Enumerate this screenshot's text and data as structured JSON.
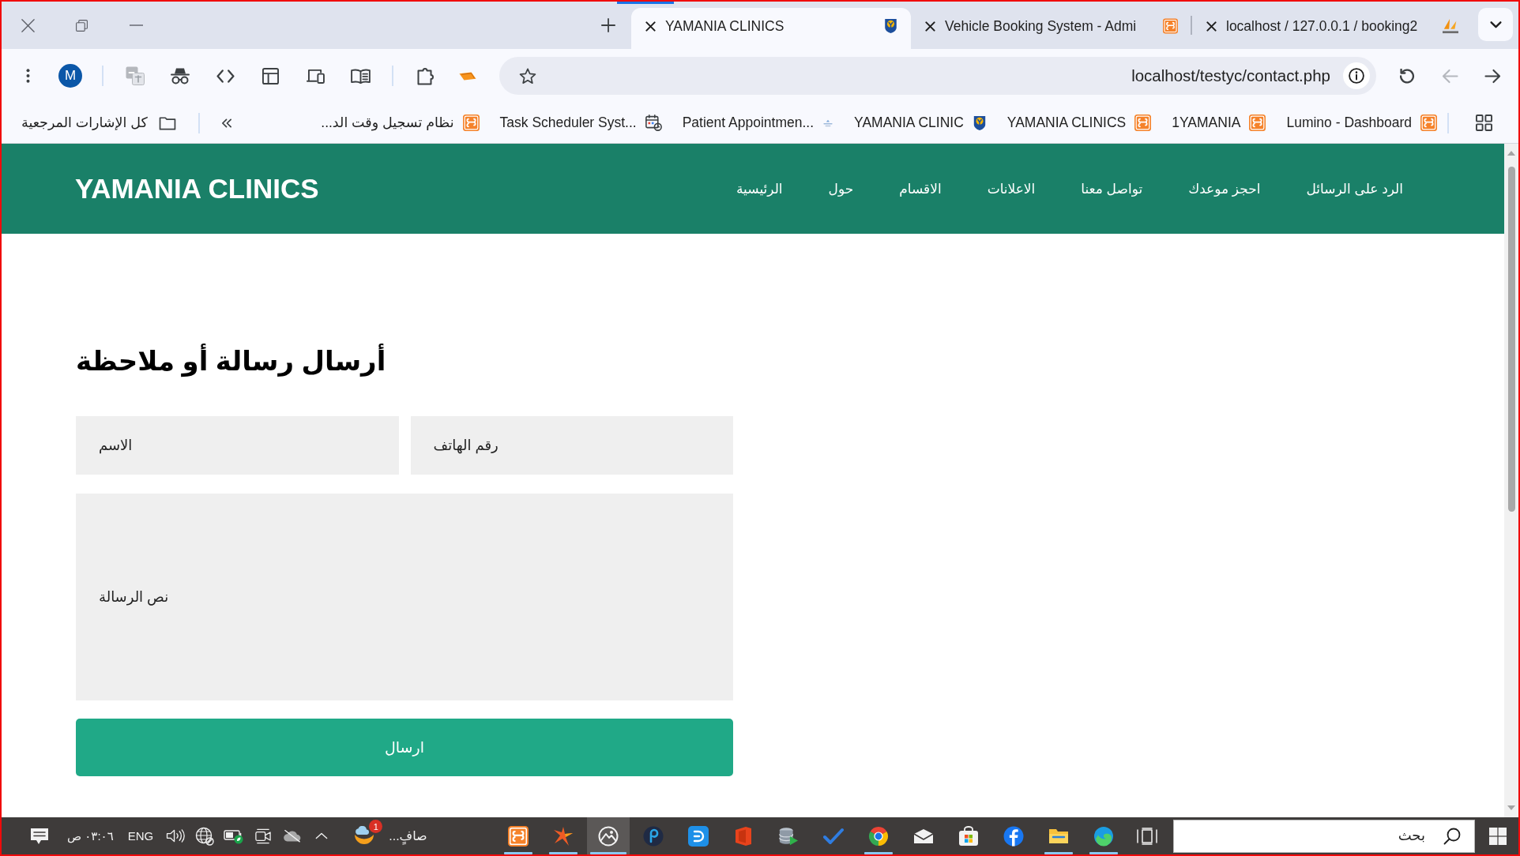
{
  "window": {
    "tabs": [
      {
        "title": "localhost / 127.0.0.1 / booking2",
        "selected": false
      },
      {
        "title": "Vehicle Booking System - Admi",
        "selected": false
      },
      {
        "title": "YAMANIA CLINICS",
        "selected": true
      }
    ]
  },
  "toolbar": {
    "profile_initial": "M",
    "url": "localhost/testyc/contact.php",
    "back": {
      "disabled": false
    },
    "forward": {
      "disabled": true
    }
  },
  "bookmarks_bar": {
    "items": [
      {
        "label": "Lumino - Dashboard"
      },
      {
        "label": "1YAMANIA"
      },
      {
        "label": "YAMANIA CLINICS"
      },
      {
        "label": "YAMANIA CLINIC"
      },
      {
        "label": "Patient Appointmen..."
      },
      {
        "label": "Task Scheduler Syst..."
      },
      {
        "label": "نظام تسجيل وقت الد..."
      }
    ],
    "all_bookmarks": "كل الإشارات المرجعية"
  },
  "page": {
    "logo": "YAMANIA CLINICS",
    "nav": [
      "الرد على الرسائل",
      "احجز موعدك",
      "تواصل معنا",
      "الاعلانات",
      "الاقسام",
      "حول",
      "الرئيسية"
    ],
    "heading": "أرسال رسالة أو ملاحظة",
    "form": {
      "fields": [
        {
          "placeholder": "رقم الهاتف"
        },
        {
          "placeholder": "الاسم"
        }
      ],
      "message": {
        "placeholder": "نص الرسالة"
      },
      "submit": "ارسال"
    }
  },
  "taskbar": {
    "clock": "٠٣:٠٦ ص",
    "language": "ENG",
    "weather": {
      "badge": "1",
      "text": "صافٍ..."
    },
    "apps": [
      {
        "running": true,
        "highlighted": false
      },
      {
        "running": true,
        "highlighted": false
      },
      {
        "running": true,
        "highlighted": true
      },
      {
        "running": false,
        "highlighted": false
      },
      {
        "running": false,
        "highlighted": false
      },
      {
        "running": false,
        "highlighted": false
      },
      {
        "running": false,
        "highlighted": false
      },
      {
        "running": false,
        "highlighted": false
      },
      {
        "running": true,
        "highlighted": false
      },
      {
        "running": false,
        "highlighted": false
      },
      {
        "running": false,
        "highlighted": false
      },
      {
        "running": false,
        "highlighted": false
      },
      {
        "running": true,
        "highlighted": false
      },
      {
        "running": true,
        "highlighted": false
      }
    ],
    "search": {
      "placeholder": "بحث"
    }
  }
}
